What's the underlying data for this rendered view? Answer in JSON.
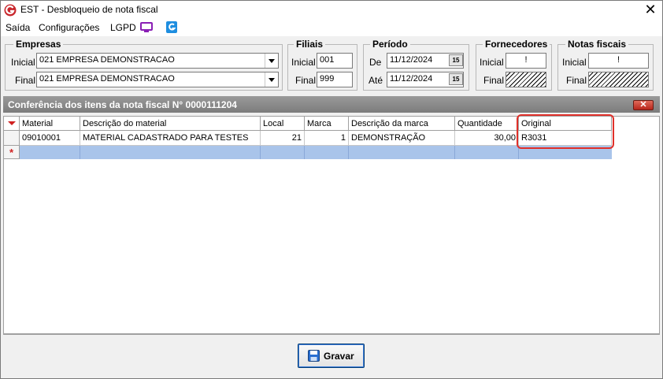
{
  "window": {
    "title": "EST - Desbloqueio de nota fiscal",
    "close_glyph": "✕"
  },
  "menu": {
    "items": [
      "Saída",
      "Configurações",
      "LGPD"
    ]
  },
  "empresas": {
    "title": "Empresas",
    "inicial_label": "Inicial",
    "inicial_value": "021 EMPRESA DEMONSTRACAO",
    "final_label": "Final",
    "final_value": "021 EMPRESA DEMONSTRACAO"
  },
  "filiais": {
    "title": "Filiais",
    "inicial_label": "Inicial",
    "inicial_value": "001",
    "final_label": "Final",
    "final_value": "999"
  },
  "periodo": {
    "title": "Período",
    "de_label": "De",
    "de_value": "11/12/2024",
    "ate_label": "Até",
    "ate_value": "11/12/2024",
    "calendar_glyph": "15"
  },
  "fornecedores": {
    "title": "Fornecedores",
    "inicial_label": "Inicial",
    "inicial_value": "!",
    "final_label": "Final"
  },
  "notas": {
    "title": "Notas fiscais",
    "inicial_label": "Inicial",
    "inicial_value": "!",
    "final_label": "Final"
  },
  "panel": {
    "title": "Conferência dos itens da nota fiscal N° 0000111204",
    "close_glyph": "✕"
  },
  "grid": {
    "headers": [
      "Material",
      "Descrição do material",
      "Local",
      "Marca",
      "Descrição da marca",
      "Quantidade",
      "Original"
    ],
    "rows": [
      {
        "material": "09010001",
        "descricao": "MATERIAL CADASTRADO PARA TESTES",
        "local": "21",
        "marca": "1",
        "descricao_marca": "DEMONSTRAÇÃO",
        "quantidade": "30,00",
        "original": "R3031"
      }
    ],
    "new_row_marker": "*"
  },
  "footer": {
    "save_label": "Gravar"
  },
  "colors": {
    "accent": "#3d7bd9",
    "highlight": "#e0302a",
    "panel_header": "#8a8a8a",
    "new_row": "#a9c4ea"
  }
}
